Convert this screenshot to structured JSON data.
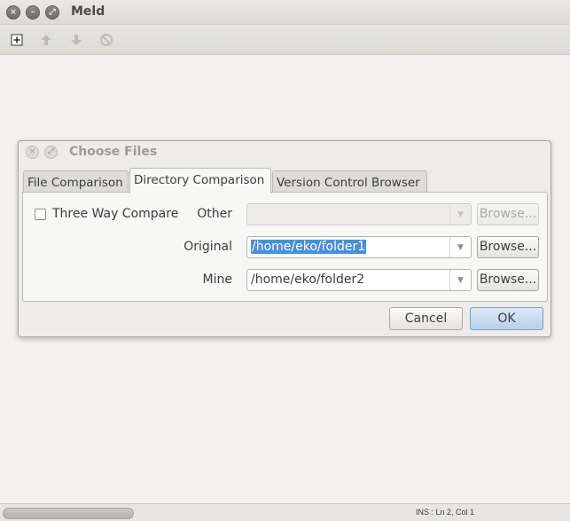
{
  "window": {
    "title": "Meld",
    "controls": {
      "close": "×",
      "minimize": "–",
      "maximize": "⤢"
    }
  },
  "toolbar": {
    "icons": [
      "new-comparison-icon",
      "arrow-up-icon",
      "arrow-down-icon",
      "stop-icon"
    ]
  },
  "dialog": {
    "title": "Choose Files",
    "tabs": [
      {
        "label": "File Comparison",
        "active": false
      },
      {
        "label": "Directory Comparison",
        "active": true
      },
      {
        "label": "Version Control Browser",
        "active": false
      }
    ],
    "three_way": {
      "label": "Three Way Compare",
      "checked": false
    },
    "fields": {
      "other": {
        "label": "Other",
        "value": "",
        "enabled": false,
        "browse_label": "Browse..."
      },
      "original": {
        "label": "Original",
        "value": "/home/eko/folder1",
        "selected": true,
        "browse_label": "Browse..."
      },
      "mine": {
        "label": "Mine",
        "value": "/home/eko/folder2",
        "browse_label": "Browse..."
      }
    },
    "buttons": {
      "cancel": "Cancel",
      "ok": "OK"
    }
  },
  "statusbar": {
    "text": "INS : Ln 2, Col 1"
  },
  "colors": {
    "selection": "#4a90d9",
    "primary_button": "#b8cfea"
  }
}
